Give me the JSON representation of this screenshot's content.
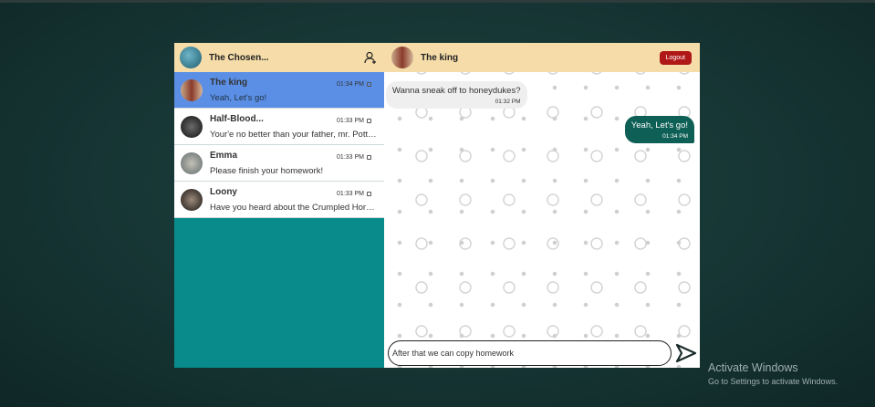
{
  "user": {
    "name": "The Chosen..."
  },
  "chats": [
    {
      "name": "The king",
      "last": "Yeah, Let's go!",
      "time": "01:34 PM",
      "active": true
    },
    {
      "name": "Half-Blood...",
      "last": "Your'e no better than your father, mr. Potter.",
      "time": "01:33 PM"
    },
    {
      "name": "Emma",
      "last": "Please finish your homework!",
      "time": "01:33 PM"
    },
    {
      "name": "Loony",
      "last": "Have you heard about the Crumpled Horn Snorkack?",
      "time": "01:33 PM"
    }
  ],
  "conversation": {
    "name": "The king",
    "logout": "Logout",
    "messages": [
      {
        "text": "Wanna sneak off to honeydukes?",
        "time": "01:32 PM",
        "dir": "in"
      },
      {
        "text": "Yeah, Let's go!",
        "time": "01:34 PM",
        "dir": "out"
      }
    ],
    "input_value": "After that we can copy homework"
  },
  "watermark": {
    "title": "Activate Windows",
    "sub": "Go to Settings to activate Windows."
  },
  "colors": {
    "header": "#f5dca8",
    "active": "#5b8fe6",
    "sidebar": "#0a8b8b",
    "outgoing": "#0e5f55",
    "logout": "#b01818"
  }
}
